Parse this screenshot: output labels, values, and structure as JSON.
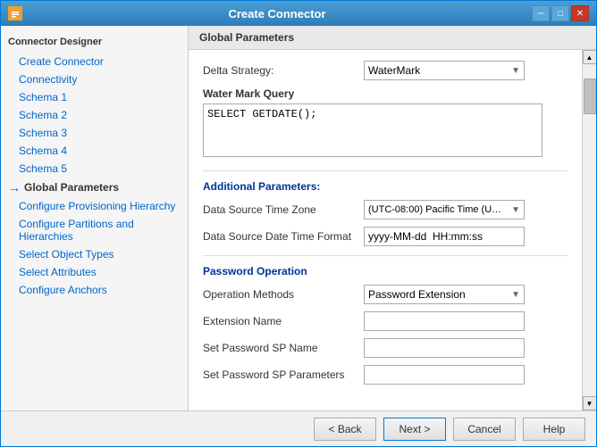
{
  "window": {
    "title": "Create Connector",
    "icon": "⚙"
  },
  "sidebar": {
    "header": "Connector Designer",
    "items": [
      {
        "id": "create-connector",
        "label": "Create Connector",
        "active": false,
        "current": false
      },
      {
        "id": "connectivity",
        "label": "Connectivity",
        "active": false,
        "current": false
      },
      {
        "id": "schema1",
        "label": "Schema 1",
        "active": false,
        "current": false
      },
      {
        "id": "schema2",
        "label": "Schema 2",
        "active": false,
        "current": false
      },
      {
        "id": "schema3",
        "label": "Schema 3",
        "active": false,
        "current": false
      },
      {
        "id": "schema4",
        "label": "Schema 4",
        "active": false,
        "current": false
      },
      {
        "id": "schema5",
        "label": "Schema 5",
        "active": false,
        "current": false
      },
      {
        "id": "global-parameters",
        "label": "Global Parameters",
        "active": true,
        "current": true
      },
      {
        "id": "configure-provisioning-hierarchy",
        "label": "Configure Provisioning Hierarchy",
        "active": false,
        "current": false
      },
      {
        "id": "configure-partitions-hierarchies",
        "label": "Configure Partitions and Hierarchies",
        "active": false,
        "current": false
      },
      {
        "id": "select-object-types",
        "label": "Select Object Types",
        "active": false,
        "current": false
      },
      {
        "id": "select-attributes",
        "label": "Select Attributes",
        "active": false,
        "current": false
      },
      {
        "id": "configure-anchors",
        "label": "Configure Anchors",
        "active": false,
        "current": false
      }
    ]
  },
  "main": {
    "header": "Global Parameters",
    "delta_strategy_label": "Delta Strategy:",
    "delta_strategy_value": "WaterMark",
    "water_mark_query_label": "Water Mark Query",
    "water_mark_query_value": "SELECT GETDATE();",
    "additional_params_label": "Additional Parameters:",
    "data_source_timezone_label": "Data Source Time Zone",
    "data_source_timezone_value": "(UTC-08:00) Pacific Time (US & C...",
    "data_source_datetime_label": "Data Source Date Time Format",
    "data_source_datetime_value": "yyyy-MM-dd  HH:mm:ss",
    "password_operation_label": "Password Operation",
    "operation_methods_label": "Operation Methods",
    "operation_methods_value": "Password Extension",
    "extension_name_label": "Extension Name",
    "extension_name_value": "",
    "set_password_sp_label": "Set Password SP Name",
    "set_password_sp_value": "",
    "set_password_params_label": "Set Password SP Parameters",
    "set_password_params_value": ""
  },
  "footer": {
    "back_label": "< Back",
    "next_label": "Next >",
    "cancel_label": "Cancel",
    "help_label": "Help"
  }
}
